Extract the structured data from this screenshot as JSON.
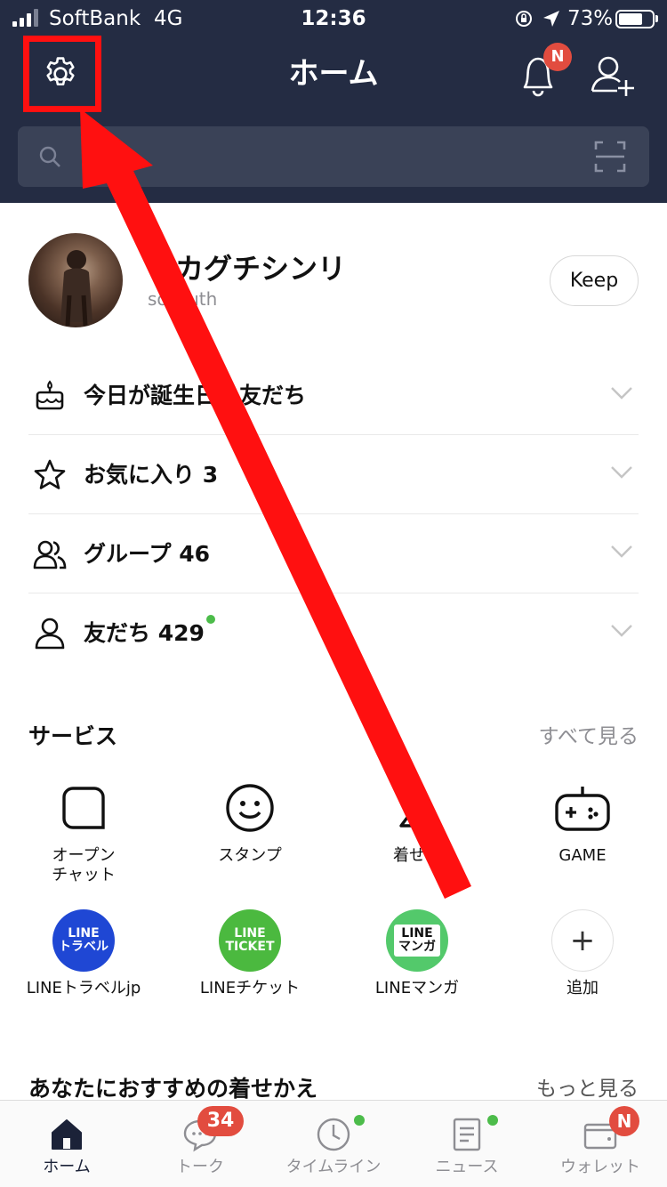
{
  "status_bar": {
    "carrier": "SoftBank",
    "network": "4G",
    "time": "12:36",
    "battery": "73%",
    "battery_level": 0.73
  },
  "header": {
    "title": "ホーム",
    "notification_badge": "N"
  },
  "profile": {
    "name": "ナカグチシンリ",
    "status": "so  truth",
    "keep_label": "Keep"
  },
  "lists": [
    {
      "label": "今日が誕生日の友だち",
      "icon": "cake-icon"
    },
    {
      "label": "お気に入り 3",
      "icon": "star-icon"
    },
    {
      "label": "グループ 46",
      "icon": "group-icon"
    },
    {
      "label": "友だち 429",
      "icon": "person-icon"
    }
  ],
  "services": {
    "title": "サービス",
    "see_all": "すべて見る",
    "items": [
      {
        "label": "オープン\nチャット",
        "icon": "open-chat-icon"
      },
      {
        "label": "スタンプ",
        "icon": "sticker-icon"
      },
      {
        "label": "着せか",
        "icon": "theme-icon"
      },
      {
        "label": "GAME",
        "icon": "game-icon"
      },
      {
        "label": "LINEトラベルjp",
        "logo_text": "LINE\nトラベル",
        "color": "#1f47d4"
      },
      {
        "label": "LINEチケット",
        "logo_text": "LINE\nTICKET",
        "color": "#4bb93f"
      },
      {
        "label": "LINEマンガ",
        "logo_text": "LINE\nマンガ",
        "color": "#53c96b"
      },
      {
        "label": "追加",
        "icon": "plus-icon"
      }
    ]
  },
  "recommendation": {
    "title": "あなたにおすすめの着せかえ",
    "more": "もっと見る"
  },
  "tabs": [
    {
      "label": "ホーム",
      "icon": "home-icon"
    },
    {
      "label": "トーク",
      "badge": "34",
      "icon": "chat-icon"
    },
    {
      "label": "タイムライン",
      "icon": "clock-icon"
    },
    {
      "label": "ニュース",
      "icon": "news-icon"
    },
    {
      "label": "ウォレット",
      "badge": "N",
      "icon": "wallet-icon"
    }
  ],
  "colors": {
    "header_bg": "#242c43",
    "annotation_red": "#ff1010",
    "badge_red": "#e24c3f",
    "dot_green": "#4cbc4a"
  }
}
